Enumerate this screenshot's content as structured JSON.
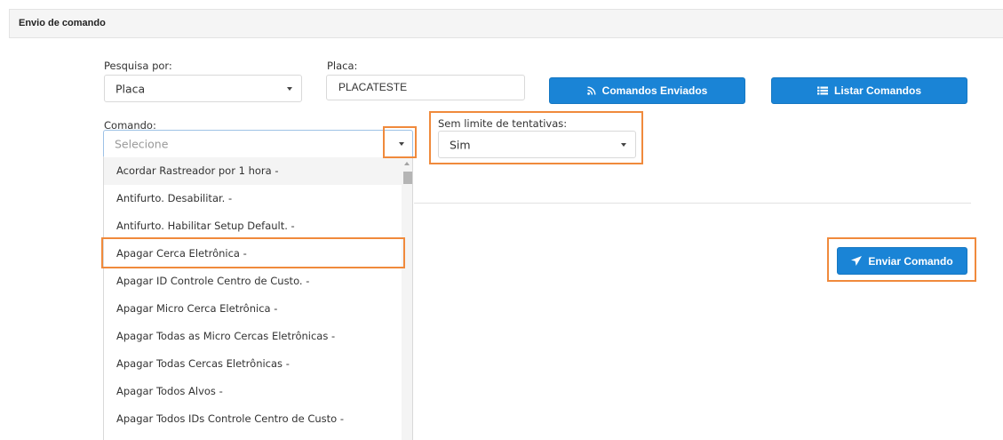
{
  "panel": {
    "title": "Envio de comando"
  },
  "search": {
    "label": "Pesquisa por:",
    "value": "Placa"
  },
  "plate": {
    "label": "Placa:",
    "value": "PLACATESTE"
  },
  "buttons": {
    "sent_commands": "Comandos Enviados",
    "list_commands": "Listar Comandos",
    "send_command": "Enviar Comando"
  },
  "command": {
    "label": "Comando:",
    "placeholder": "Selecione",
    "options": [
      "Acordar Rastreador por 1 hora -",
      "Antifurto. Desabilitar. -",
      "Antifurto. Habilitar Setup Default. -",
      "Apagar Cerca Eletrônica -",
      "Apagar ID Controle Centro de Custo. -",
      "Apagar Micro Cerca Eletrônica -",
      "Apagar Todas as Micro Cercas Eletrônicas -",
      "Apagar Todas Cercas Eletrônicas -",
      "Apagar Todos Alvos -",
      "Apagar Todos IDs Controle Centro de Custo -"
    ]
  },
  "retry": {
    "label": "Sem limite de tentativas:",
    "value": "Sim"
  },
  "colors": {
    "primary": "#1a84d6",
    "highlight": "#f08a3c"
  }
}
